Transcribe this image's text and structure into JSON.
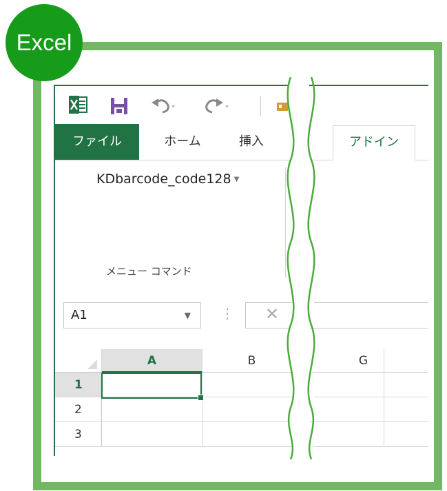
{
  "badge": {
    "label": "Excel"
  },
  "qat": {
    "icons": [
      "excel-logo-icon",
      "save-icon",
      "undo-icon",
      "redo-icon",
      "customize-icon"
    ]
  },
  "tabs": [
    {
      "label": "ファイル"
    },
    {
      "label": "ホーム"
    },
    {
      "label": "挿入"
    },
    {
      "label": "アドイン"
    }
  ],
  "ribbon": {
    "button_label": "KDbarcode_code128",
    "group_label": "メニュー コマンド"
  },
  "formula_bar": {
    "name_box_value": "A1",
    "cancel_glyph": "✕"
  },
  "grid": {
    "columns": [
      "A",
      "B",
      "G"
    ],
    "rows": [
      "1",
      "2",
      "3"
    ],
    "selected_cell": "A1"
  },
  "colors": {
    "excel_green": "#217346",
    "frame_green": "#71b862",
    "badge_green": "#179b1b"
  }
}
